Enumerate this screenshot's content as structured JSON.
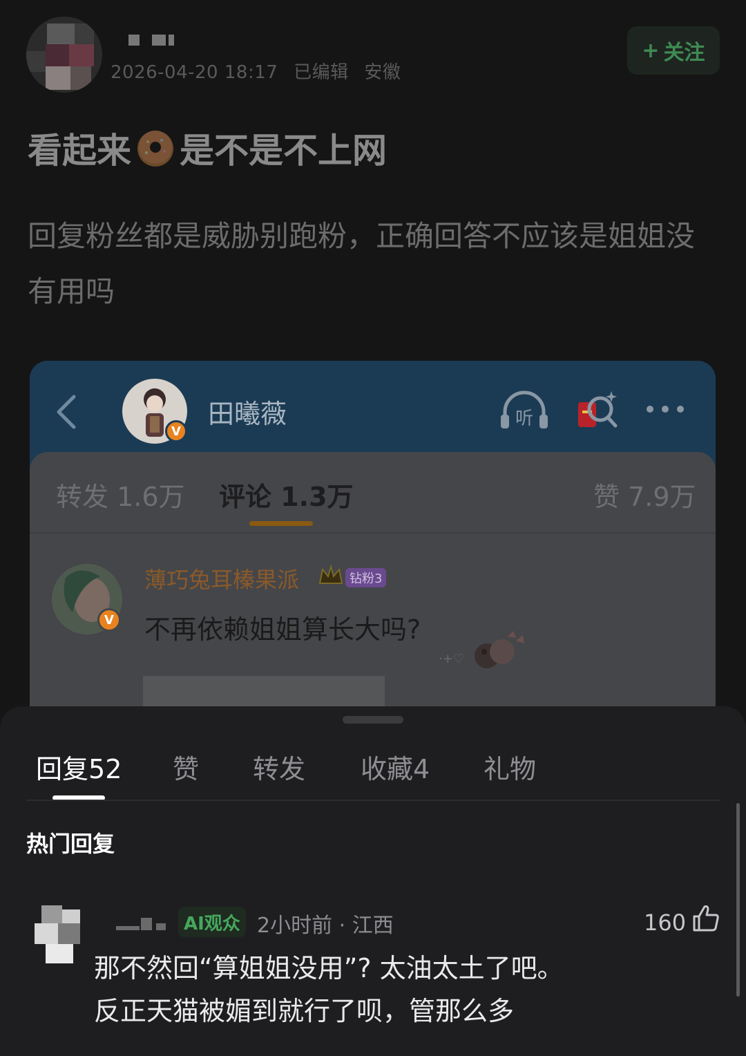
{
  "post": {
    "timestamp": "2026-04-20 18:17",
    "edited": "已编辑",
    "location": "安徽",
    "follow_label": "关注",
    "follow_plus": "+",
    "title_before": "看起来",
    "title_after": "是不是不上网",
    "body": "回复粉丝都是威胁别跑粉，正确回答不应该是姐姐没有用吗"
  },
  "screenshot": {
    "account_name": "田曦薇",
    "verified_mark": "V",
    "listen_label": "听",
    "tabs": [
      {
        "label": "转发 1.6万"
      },
      {
        "label": "评论 1.3万"
      },
      {
        "label": "赞 7.9万"
      }
    ],
    "comment": {
      "user": "薄巧兔耳榛果派",
      "badge": "钻粉3",
      "verified_mark": "V",
      "text": "不再依赖姐姐算长大吗?"
    }
  },
  "sheet": {
    "tabs": [
      {
        "label": "回复",
        "count": "52"
      },
      {
        "label": "赞",
        "count": ""
      },
      {
        "label": "转发",
        "count": ""
      },
      {
        "label": "收藏",
        "count": "4"
      },
      {
        "label": "礼物",
        "count": ""
      }
    ],
    "section_title": "热门回复",
    "reply": {
      "badge": "AI观众",
      "meta": "2小时前 · 江西",
      "likes": "160",
      "line1": "那不然回“算姐姐没用”? 太油太土了吧。",
      "line2": "反正天猫被媚到就行了呗，管那么多"
    }
  },
  "colors": {
    "background": "#151515",
    "sheet": "#1e1e21",
    "follow_green": "#3f8a54",
    "ai_green": "#45a85c",
    "orange_badge": "#e8831f"
  }
}
